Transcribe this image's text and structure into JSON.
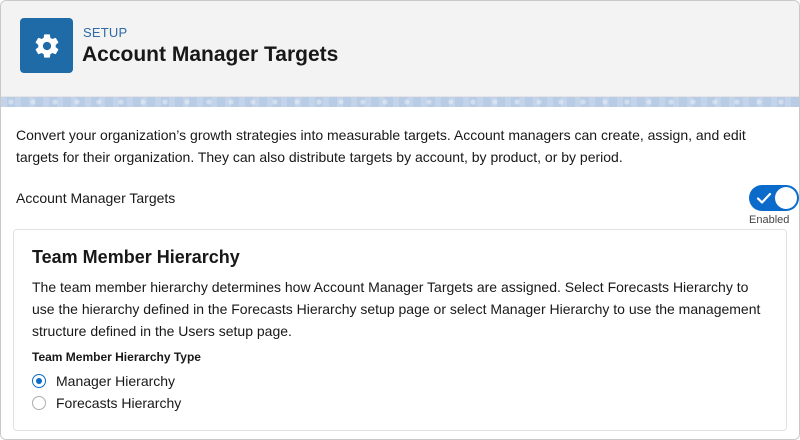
{
  "header": {
    "setup_label": "SETUP",
    "title": "Account Manager Targets",
    "icon": "gear-icon"
  },
  "description": "Convert your organization’s growth strategies into measurable targets. Account managers can create, assign, and edit targets for their organization. They can also distribute targets by account, by product, or by period.",
  "feature_toggle": {
    "label": "Account Manager Targets",
    "state_label": "Enabled",
    "enabled": true
  },
  "hierarchy_card": {
    "title": "Team Member Hierarchy",
    "description": "The team member hierarchy determines how Account Manager Targets are assigned. Select Forecasts Hierarchy to use the hierarchy defined in the Forecasts Hierarchy setup page or select Manager Hierarchy to use the management structure defined in the Users setup page.",
    "type_label": "Team Member Hierarchy Type",
    "options": [
      {
        "label": "Manager Hierarchy",
        "selected": true
      },
      {
        "label": "Forecasts Hierarchy",
        "selected": false
      }
    ]
  },
  "colors": {
    "brand_blue": "#0b6bcb",
    "icon_bg": "#1e6ba8",
    "setup_label": "#2e6aa6"
  }
}
